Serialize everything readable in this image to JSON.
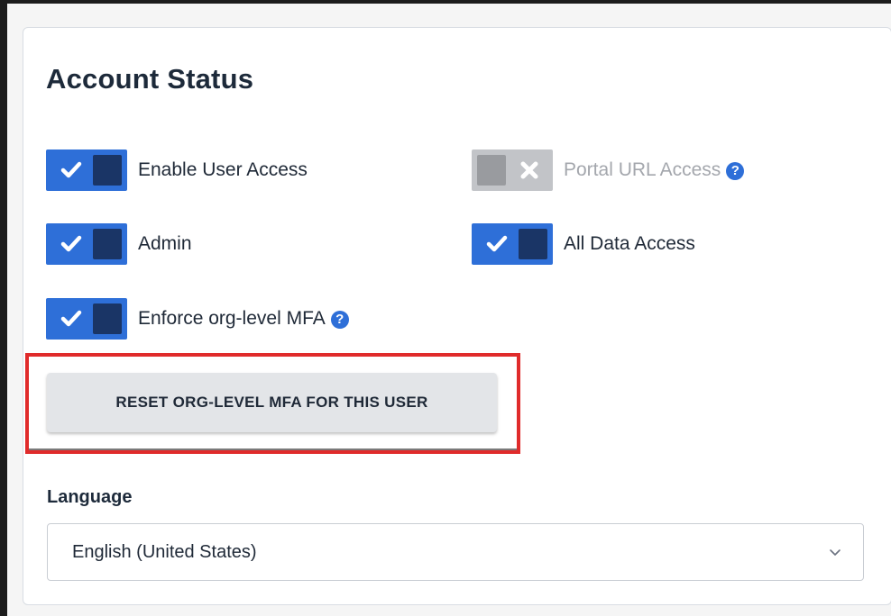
{
  "section": {
    "title": "Account Status"
  },
  "toggles": [
    {
      "label": "Enable User Access",
      "on": true
    },
    {
      "label": "Portal URL Access",
      "on": false,
      "disabled": true,
      "help": "?"
    },
    {
      "label": "Admin",
      "on": true
    },
    {
      "label": "All Data Access",
      "on": true
    },
    {
      "label": "Enforce org-level MFA",
      "on": true,
      "help": "?"
    }
  ],
  "reset_button": {
    "label": "RESET ORG-LEVEL MFA FOR THIS USER"
  },
  "language": {
    "label": "Language",
    "selected": "English (United States)"
  },
  "colors": {
    "accent": "#2e6fd8",
    "knob": "#1a3566",
    "highlight": "#e02b2b",
    "disabled": "#c2c4c8"
  },
  "icons": {
    "check": "check-icon",
    "cross": "x-icon",
    "help": "question-circle-icon",
    "chevron": "chevron-down-icon"
  }
}
